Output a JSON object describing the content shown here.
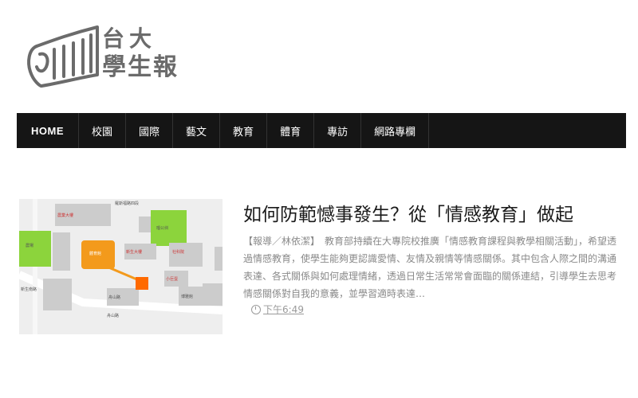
{
  "site": {
    "name_line1": "台大",
    "name_line2": "學生報"
  },
  "nav": {
    "items": [
      "HOME",
      "校園",
      "國際",
      "藝文",
      "教育",
      "體育",
      "專訪",
      "網路專欄"
    ]
  },
  "article": {
    "title": "如何防範憾事發生？從「情感教育」做起",
    "excerpt": "【報導／林依潔】　教育部持續在大專院校推廣「情感教育課程與教學相關活動」，希望透過情感教育，使學生能夠更認識愛情、友情及親情等情感關係。其中包含人際之間的溝通表達、各式關係與如何處理情緒，透過日常生活常常會面臨的關係連結，引導學生去思考情感關係對自我的意義，並學習適時表達…",
    "time": "下午6:49",
    "thumbnail": {
      "top_road": "羅斯福路四段",
      "left_road": "舟山路",
      "labels": [
        "農場",
        "瑠公圳",
        "農業大樓",
        "新生大樓",
        "小巨蛋",
        "體育館",
        "舟山路",
        "新生南路",
        "社科院",
        "博雅館"
      ]
    }
  },
  "colors": {
    "nav_bg": "#151515",
    "logo_gray": "#6b6b6b",
    "title": "#1a1a1a",
    "excerpt": "#8a8a8a",
    "map_green": "#8cd43c",
    "map_orange": "#f39a1c",
    "map_marker": "#ff6a00"
  }
}
